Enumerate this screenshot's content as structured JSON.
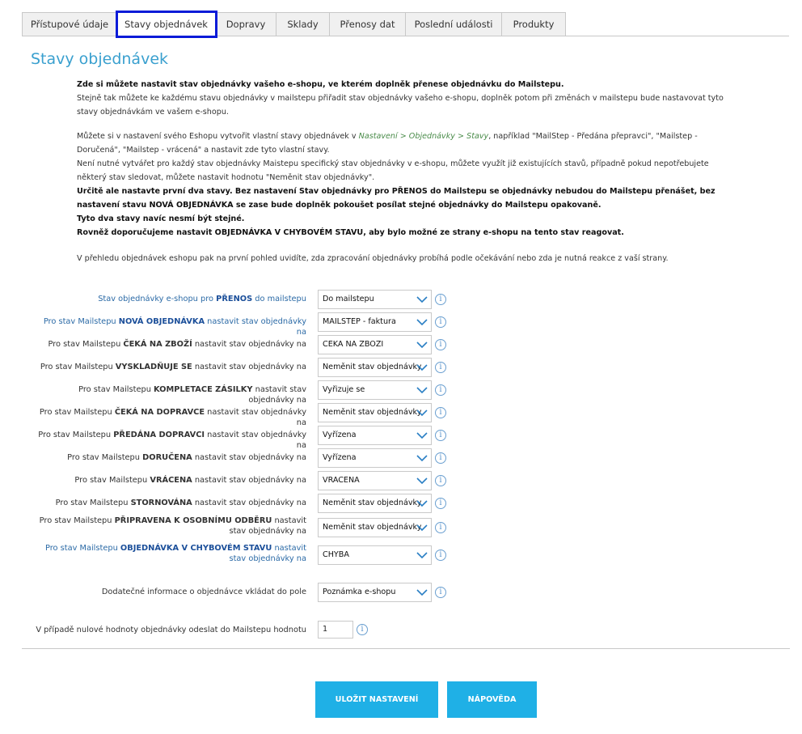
{
  "tabs": [
    {
      "label": "Přístupové údaje",
      "active": false
    },
    {
      "label": "Stavy objednávek",
      "active": true
    },
    {
      "label": "Dopravy",
      "active": false
    },
    {
      "label": "Sklady",
      "active": false
    },
    {
      "label": "Přenosy dat",
      "active": false
    },
    {
      "label": "Poslední události",
      "active": false
    },
    {
      "label": "Produkty",
      "active": false
    }
  ],
  "page_title": "Stavy objednávek",
  "intro": {
    "p1_bold": "Zde si můžete nastavit stav objednávky vašeho e-shopu, ve kterém doplněk přenese objednávku do Mailstepu.",
    "p2": "Stejně tak můžete ke každému stavu objednávky v mailstepu přiřadit stav objednávky vašeho e-shopu, doplněk potom při změnách v mailstepu bude nastavovat tyto stavy objednávkám ve vašem e-shopu.",
    "p3_a": "Můžete si v nastavení svého Eshopu vytvořit vlastní stavy objednávek v ",
    "p3_path": "Nastavení > Objednávky > Stavy",
    "p3_b": ", například \"MailStep - Předána přepravci\", \"Mailstep - Doručená\", \"Mailstep - vrácená\" a nastavit zde tyto vlastní stavy.",
    "p4": "Není nutné vytvářet pro každý stav objednávky Maistepu specifický stav objednávky v e-shopu, můžete využít již existujících stavů, případně pokud nepotřebujete některý stav sledovat, můžete nastavit hodnotu \"Neměnit stav objednávky\".",
    "p5_bold": "Určitě ale nastavte první dva stavy. Bez nastavení Stav objednávky pro PŘENOS do Mailstepu se objednávky nebudou do Mailstepu přenášet, bez nastavení stavu NOVÁ OBJEDNÁVKA se zase bude doplněk pokoušet posílat stejné objednávky do Mailstepu opakovaně.",
    "p6_bold": "Tyto dva stavy navíc nesmí být stejné.",
    "p7_bold": "Rovněž doporučujeme nastavit OBJEDNÁVKA V CHYBOVÉM STAVU, aby bylo možné ze strany e-shopu na tento stav reagovat.",
    "p8": "V přehledu objednávek eshopu pak na první pohled uvidíte, zda zpracování objednávky probíhá podle očekávání nebo zda je nutná reakce z vaší strany."
  },
  "rows": [
    {
      "pre": "Stav objednávky e-shopu pro ",
      "bold": "PŘENOS",
      "post": " do mailstepu",
      "blue": true,
      "value": "Do mailstepu"
    },
    {
      "pre": "Pro stav Mailstepu ",
      "bold": "NOVÁ OBJEDNÁVKA",
      "post": " nastavit stav objednávky na",
      "blue": true,
      "value": "MAILSTEP - faktura"
    },
    {
      "pre": "Pro stav Mailstepu ",
      "bold": "ČEKÁ NA ZBOŽÍ",
      "post": " nastavit stav objednávky na",
      "blue": false,
      "value": "CEKA NA ZBOZI"
    },
    {
      "pre": "Pro stav Mailstepu ",
      "bold": "VYSKLADŇUJE SE",
      "post": " nastavit stav objednávky na",
      "blue": false,
      "value": "Neměnit stav objednávky"
    },
    {
      "pre": "Pro stav Mailstepu ",
      "bold": "KOMPLETACE ZÁSILKY",
      "post": " nastavit stav objednávky na",
      "blue": false,
      "value": "Vyřizuje se"
    },
    {
      "pre": "Pro stav Mailstepu ",
      "bold": "ČEKÁ NA DOPRAVCE",
      "post": " nastavit stav objednávky na",
      "blue": false,
      "value": "Neměnit stav objednávky"
    },
    {
      "pre": "Pro stav Mailstepu ",
      "bold": "PŘEDÁNA DOPRAVCI",
      "post": " nastavit stav objednávky na",
      "blue": false,
      "value": "Vyřízena"
    },
    {
      "pre": "Pro stav Mailstepu ",
      "bold": "DORUČENA",
      "post": " nastavit stav objednávky na",
      "blue": false,
      "value": "Vyřízena"
    },
    {
      "pre": "Pro stav Mailstepu ",
      "bold": "VRÁCENA",
      "post": " nastavit stav objednávky na",
      "blue": false,
      "value": "VRACENA"
    },
    {
      "pre": "Pro stav Mailstepu ",
      "bold": "STORNOVÁNA",
      "post": " nastavit stav objednávky na",
      "blue": false,
      "value": "Neměnit stav objednávky"
    },
    {
      "pre": "Pro stav Mailstepu ",
      "bold": "PŘIPRAVENA K OSOBNÍMU ODBĚRU",
      "post": " nastavit stav objednávky na",
      "blue": false,
      "value": "Neměnit stav objednávky"
    },
    {
      "pre": "Pro stav Mailstepu ",
      "bold": "OBJEDNÁVKA V CHYBOVÉM STAVU",
      "post": " nastavit stav objednávky na",
      "blue": true,
      "value": "CHYBA"
    }
  ],
  "extra_row": {
    "label": "Dodatečné informace o objednávce vkládat do pole",
    "value": "Poznámka e-shopu"
  },
  "zero_row": {
    "label": "V případě nulové hodnoty objednávky odeslat do Mailstepu hodnotu",
    "value": "1"
  },
  "info_glyph": "i",
  "buttons": {
    "save": "ULOŽIT NASTAVENÍ",
    "help": "NÁPOVĚDA"
  },
  "colors": {
    "accent": "#1fb0e6",
    "title": "#3aa0cf",
    "active_tab_outline": "#0a1bd8"
  }
}
